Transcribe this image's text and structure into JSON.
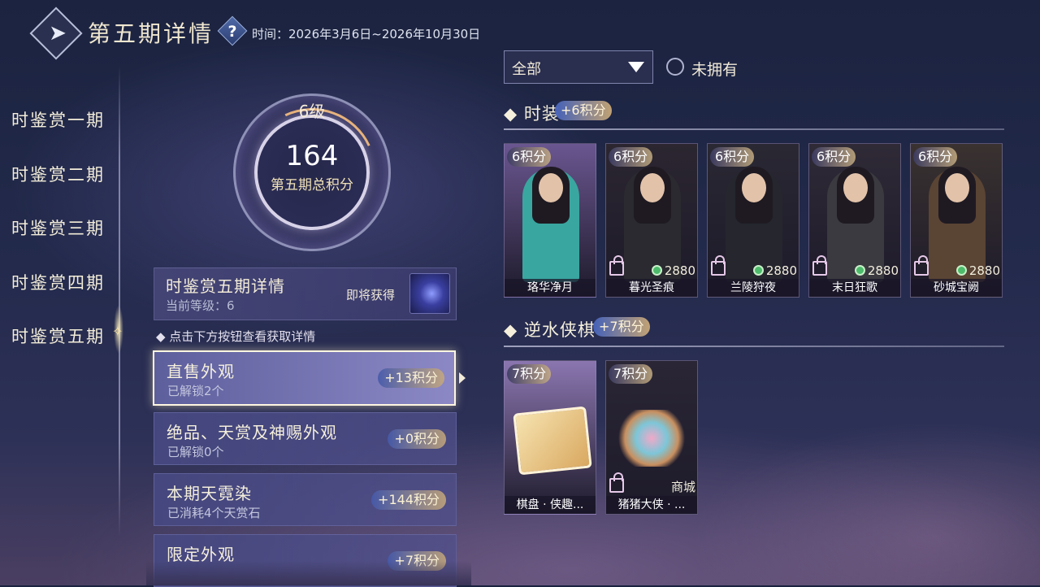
{
  "header": {
    "title": "第五期详情",
    "help_glyph": "?",
    "time_label": "时间：2026年3月6日~2026年10月30日"
  },
  "sidebar": {
    "items": [
      {
        "label": "时鉴赏一期"
      },
      {
        "label": "时鉴赏二期"
      },
      {
        "label": "时鉴赏三期"
      },
      {
        "label": "时鉴赏四期"
      },
      {
        "label": "时鉴赏五期",
        "active": true
      }
    ]
  },
  "progress": {
    "level": "6级",
    "score": "164",
    "score_label": "第五期总积分",
    "arc_fraction": 0.1
  },
  "detail": {
    "title": "时鉴赏五期详情",
    "level_text": "当前等级：6",
    "soon_label": "即将获得"
  },
  "hint": "◆ 点击下方按钮查看获取详情",
  "categories": [
    {
      "title": "直售外观",
      "sub": "已解锁2个",
      "badge": "+13积分",
      "active": true
    },
    {
      "title": "绝品、天赏及神赐外观",
      "sub": "已解锁0个",
      "badge": "+0积分"
    },
    {
      "title": "本期天霓染",
      "sub": "已消耗4个天赏石",
      "badge": "+144积分"
    },
    {
      "title": "限定外观",
      "sub": "",
      "badge": "+7积分"
    }
  ],
  "filter": {
    "selected": "全部",
    "radio_label": "未拥有"
  },
  "sections": [
    {
      "title": "时装",
      "badge": "+6积分",
      "items": [
        {
          "tag": "6积分",
          "name": "珞华净月",
          "price": "",
          "locked": false,
          "bg": "#6a5690",
          "figure": "#3aa6a0"
        },
        {
          "tag": "6积分",
          "name": "暮光圣痕",
          "price": "2880",
          "locked": true,
          "bg": "#2b2630",
          "figure": "#2a2a30"
        },
        {
          "tag": "6积分",
          "name": "兰陵狩夜",
          "price": "2880",
          "locked": true,
          "bg": "#2a2833",
          "figure": "#25262e"
        },
        {
          "tag": "6积分",
          "name": "末日狂歌",
          "price": "2880",
          "locked": true,
          "bg": "#2f2a36",
          "figure": "#3b3a40"
        },
        {
          "tag": "6积分",
          "name": "砂城宝阙",
          "price": "2880",
          "locked": true,
          "bg": "#3a3230",
          "figure": "#5a4434"
        }
      ]
    },
    {
      "title": "逆水侠棋",
      "badge": "+7积分",
      "items": [
        {
          "tag": "7积分",
          "name": "棋盘 · 侠趣...",
          "shop": "",
          "locked": false,
          "bg": "#8b76b0"
        },
        {
          "tag": "7积分",
          "name": "猪猪大侠 · ...",
          "shop": "商城",
          "locked": true,
          "bg": "#2a2636"
        }
      ]
    }
  ],
  "colors": {
    "accent": "#e8b070",
    "badge_blue": "#4664be",
    "text_light": "#f1ead8"
  }
}
